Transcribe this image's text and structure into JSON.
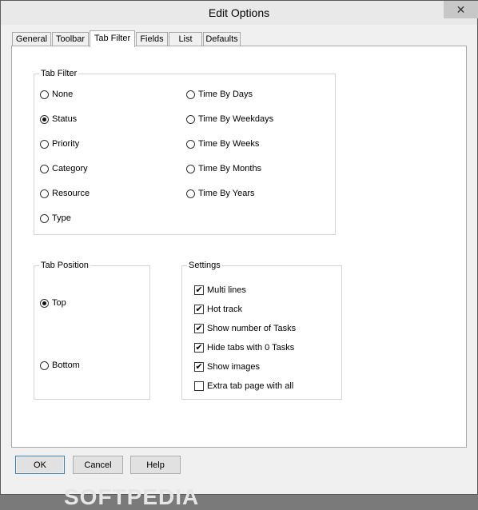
{
  "window": {
    "title": "Edit Options",
    "close_glyph": "✕"
  },
  "tabs": [
    {
      "label": "General"
    },
    {
      "label": "Toolbar"
    },
    {
      "label": "Tab Filter"
    },
    {
      "label": "Fields"
    },
    {
      "label": "List"
    },
    {
      "label": "Defaults"
    }
  ],
  "active_tab": "Tab Filter",
  "tab_filter": {
    "label": "Tab Filter",
    "options": [
      {
        "label": "None",
        "selected": false
      },
      {
        "label": "Status",
        "selected": true
      },
      {
        "label": "Priority",
        "selected": false
      },
      {
        "label": "Category",
        "selected": false
      },
      {
        "label": "Resource",
        "selected": false
      },
      {
        "label": "Type",
        "selected": false
      },
      {
        "label": "Time By Days",
        "selected": false
      },
      {
        "label": "Time By Weekdays",
        "selected": false
      },
      {
        "label": "Time By Weeks",
        "selected": false
      },
      {
        "label": "Time By Months",
        "selected": false
      },
      {
        "label": "Time By Years",
        "selected": false
      }
    ]
  },
  "tab_position": {
    "label": "Tab Position",
    "options": [
      {
        "label": "Top",
        "selected": true
      },
      {
        "label": "Bottom",
        "selected": false
      }
    ]
  },
  "settings": {
    "label": "Settings",
    "options": [
      {
        "label": "Multi lines",
        "checked": true
      },
      {
        "label": "Hot track",
        "checked": true
      },
      {
        "label": "Show number of Tasks",
        "checked": true
      },
      {
        "label": "Hide tabs with 0 Tasks",
        "checked": true
      },
      {
        "label": "Show images",
        "checked": true
      },
      {
        "label": "Extra tab page with all",
        "checked": false
      }
    ]
  },
  "buttons": {
    "ok": "OK",
    "cancel": "Cancel",
    "help": "Help"
  },
  "watermark": "SOFTPEDIA"
}
